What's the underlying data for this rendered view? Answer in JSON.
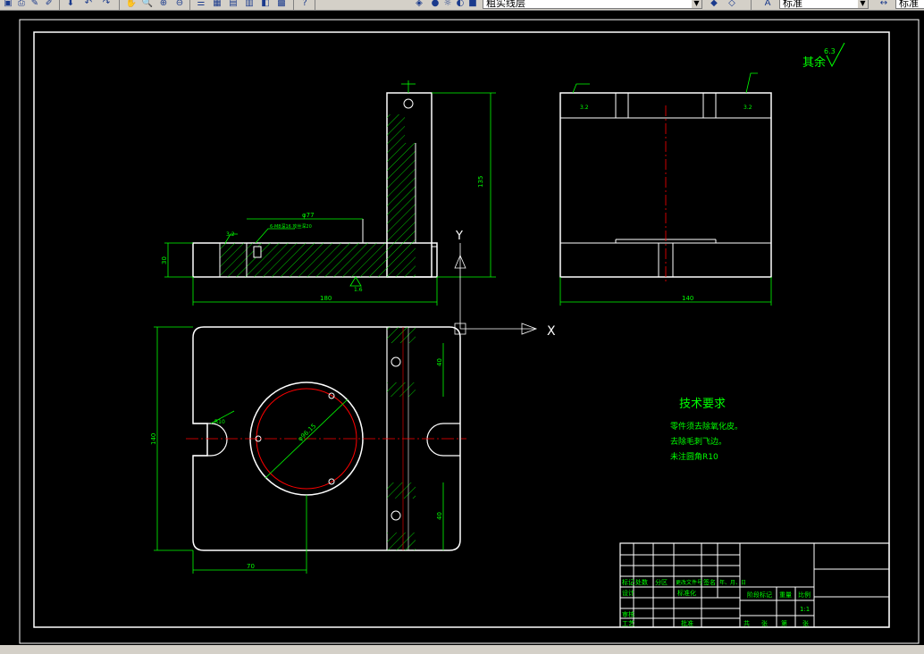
{
  "toolbar": {
    "layer_name": "粗实线层",
    "text_style": "标准",
    "dim_style": "标准"
  },
  "drawing": {
    "roughness_note": "其余",
    "roughness_value": "6.3",
    "tech_requirements": {
      "title": "技术要求",
      "lines": [
        "零件须去除氧化皮。",
        "去除毛刺飞边。",
        "未注圆角R10"
      ]
    },
    "front_view": {
      "dim_width": "180",
      "dim_height": "135",
      "dim_base": "30",
      "dim_slot": "φ77",
      "dim_rough_a": "3.2",
      "dim_rough_b": "1.6",
      "note": "6-M8深16 攻丝深20"
    },
    "side_view": {
      "dim_width": "140",
      "dim_rough_a": "3.2",
      "dim_rough_b": "3.2"
    },
    "top_view": {
      "dim_height": "140",
      "dim_offset": "70",
      "dim_circle": "φ96.15",
      "dim_r": "R10",
      "dim_hole_a": "40",
      "dim_hole_b": "40"
    },
    "axis_labels": {
      "x": "X",
      "y": "Y"
    }
  },
  "title_block": {
    "row_headers": [
      "标记",
      "处数",
      "分区",
      "更改文件号",
      "签名",
      "年、月、日"
    ],
    "designer_label": "设计",
    "standardize_label": "标准化",
    "audit_label": "审核",
    "process_label": "工艺",
    "approve_label": "批准",
    "stage_label": "阶段标记",
    "weight_label": "重量",
    "scale_label": "比例",
    "scale_value": "1:1",
    "sheet_labels": [
      "共",
      "张",
      "第",
      "张"
    ]
  },
  "colors": {
    "background": "#000000",
    "outline": "#ffffff",
    "dimension": "#00ff00",
    "centerline": "#ff0000",
    "hatch": "#00ff00"
  }
}
